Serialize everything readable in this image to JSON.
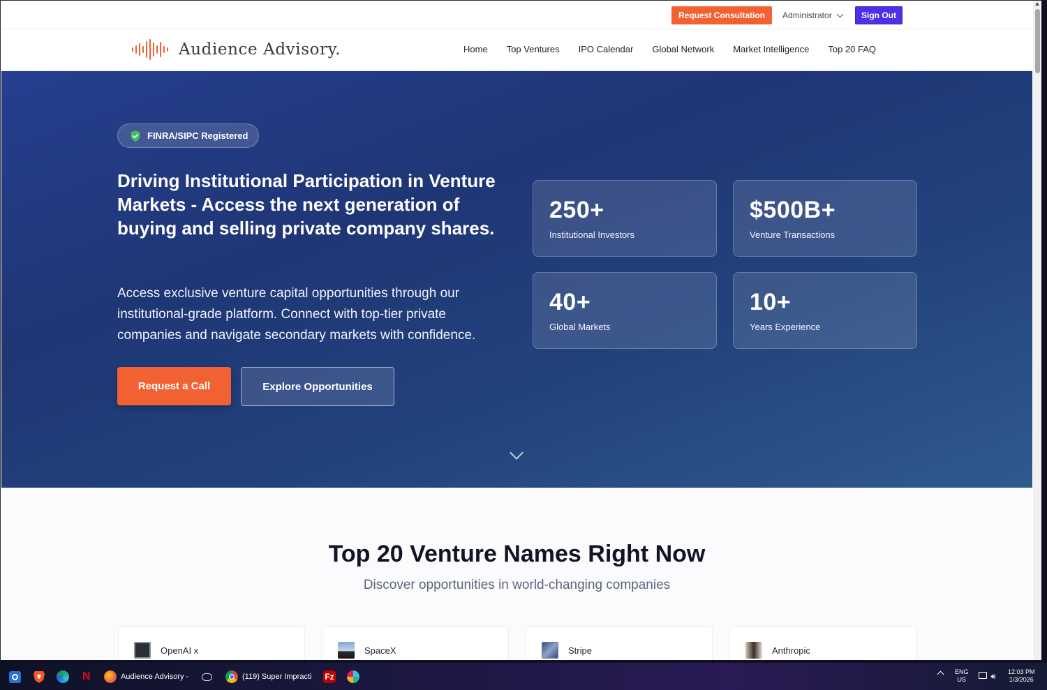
{
  "adminbar": {
    "consult_label": "Request Consultation",
    "admin_label": "Administrator",
    "signout_label": "Sign Out"
  },
  "brand": {
    "name": "Audience Advisory."
  },
  "nav": {
    "items": [
      "Home",
      "Top Ventures",
      "IPO Calendar",
      "Global Network",
      "Market Intelligence",
      "Top 20 FAQ"
    ]
  },
  "hero": {
    "badge": "FINRA/SIPC Registered",
    "title": "Driving Institutional Participation in Venture Markets - Access the next generation of buying and selling private company shares.",
    "subtitle": "Access exclusive venture capital opportunities through our institutional-grade platform. Connect with top-tier private companies and navigate secondary markets with confidence.",
    "cta_primary": "Request a Call",
    "cta_secondary": "Explore Opportunities",
    "stats": [
      {
        "value": "250+",
        "label": "Institutional Investors"
      },
      {
        "value": "$500B+",
        "label": "Venture Transactions"
      },
      {
        "value": "40+",
        "label": "Global Markets"
      },
      {
        "value": "10+",
        "label": "Years Experience"
      }
    ]
  },
  "section": {
    "title": "Top 20 Venture Names Right Now",
    "subtitle": "Discover opportunities in world-changing companies",
    "companies": [
      "OpenAI x",
      "SpaceX",
      "Stripe",
      "Anthropic"
    ]
  },
  "taskbar": {
    "firefox_label": "Audience Advisory -",
    "chrome_label": "(119) Super Impracti",
    "lang": "ENG",
    "region": "US",
    "time": "12:03 PM",
    "date": "1/3/2026"
  },
  "colors": {
    "accent_orange": "#f26132",
    "signout_purple": "#4f31e5",
    "hero_blue": "#1f3676"
  }
}
